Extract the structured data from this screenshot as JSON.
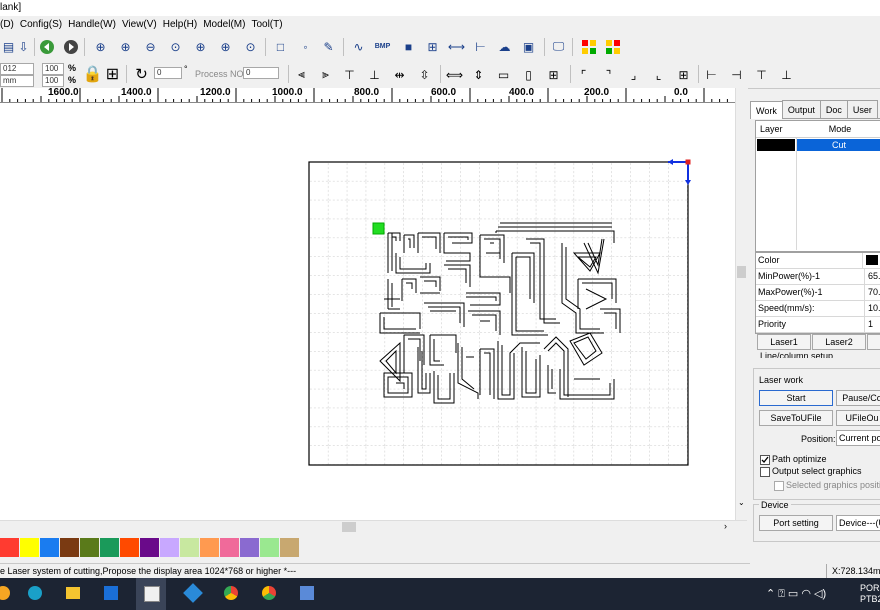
{
  "window": {
    "title": "lank]"
  },
  "menu": [
    "(D)",
    "Config(S)",
    "Handle(W)",
    "View(V)",
    "Help(H)",
    "Model(M)",
    "Tool(T)"
  ],
  "toolbar2": {
    "unit_top": "012 mm",
    "unit_bottom": "mm",
    "scale_top": "100",
    "scale_bottom": "100",
    "pct": "%",
    "rotate_value": "0",
    "degree": "°",
    "process_no_label": "Process NO:",
    "process_no_value": "0"
  },
  "ruler": {
    "labels": [
      "1600.0",
      "1400.0",
      "1200.0",
      "1000.0",
      "800.0",
      "600.0",
      "400.0",
      "200.0",
      "0.0"
    ]
  },
  "panel": {
    "tabs": [
      "Work",
      "Output",
      "Doc",
      "User"
    ],
    "layer_header": {
      "layer": "Layer",
      "mode": "Mode"
    },
    "layer_row": {
      "mode": "Cut",
      "color": "#000000"
    },
    "props": [
      {
        "k": "Color",
        "v": ""
      },
      {
        "k": "MinPower(%)-1",
        "v": "65."
      },
      {
        "k": "MaxPower(%)-1",
        "v": "70."
      },
      {
        "k": "Speed(mm/s):",
        "v": "10."
      },
      {
        "k": "Priority",
        "v": "1"
      }
    ],
    "laser1": "Laser1",
    "laser2": "Laser2",
    "line_setup": "Line/column setup",
    "laser_work_title": "Laser work",
    "start": "Start",
    "pause": "Pause/Co",
    "save": "SaveToUFile",
    "ufile": "UFileOu",
    "position_label": "Position:",
    "position_value": "Current po",
    "path_optimize": "Path optimize",
    "output_select": "Output select graphics",
    "selected_pos": "Selected graphics position",
    "device_title": "Device",
    "port_setting": "Port setting",
    "device_value": "Device---(U"
  },
  "palette": [
    "#ff3b30",
    "#ffff00",
    "#1a7cf0",
    "#7a3a12",
    "#5a7a1a",
    "#1a9a5a",
    "#ff4a00",
    "#6a0a8a",
    "#c8a8ff",
    "#c8e8a0",
    "#ff9a50",
    "#f06a9a",
    "#8a6ad0",
    "#9ae890",
    "#c8a870"
  ],
  "status": {
    "left": "e Laser system of cutting,Propose the display area 1024*768 or higher *---",
    "right": "X:728.134m"
  },
  "tray": {
    "lang_top": "POR",
    "lang_bottom": "PTB2"
  }
}
